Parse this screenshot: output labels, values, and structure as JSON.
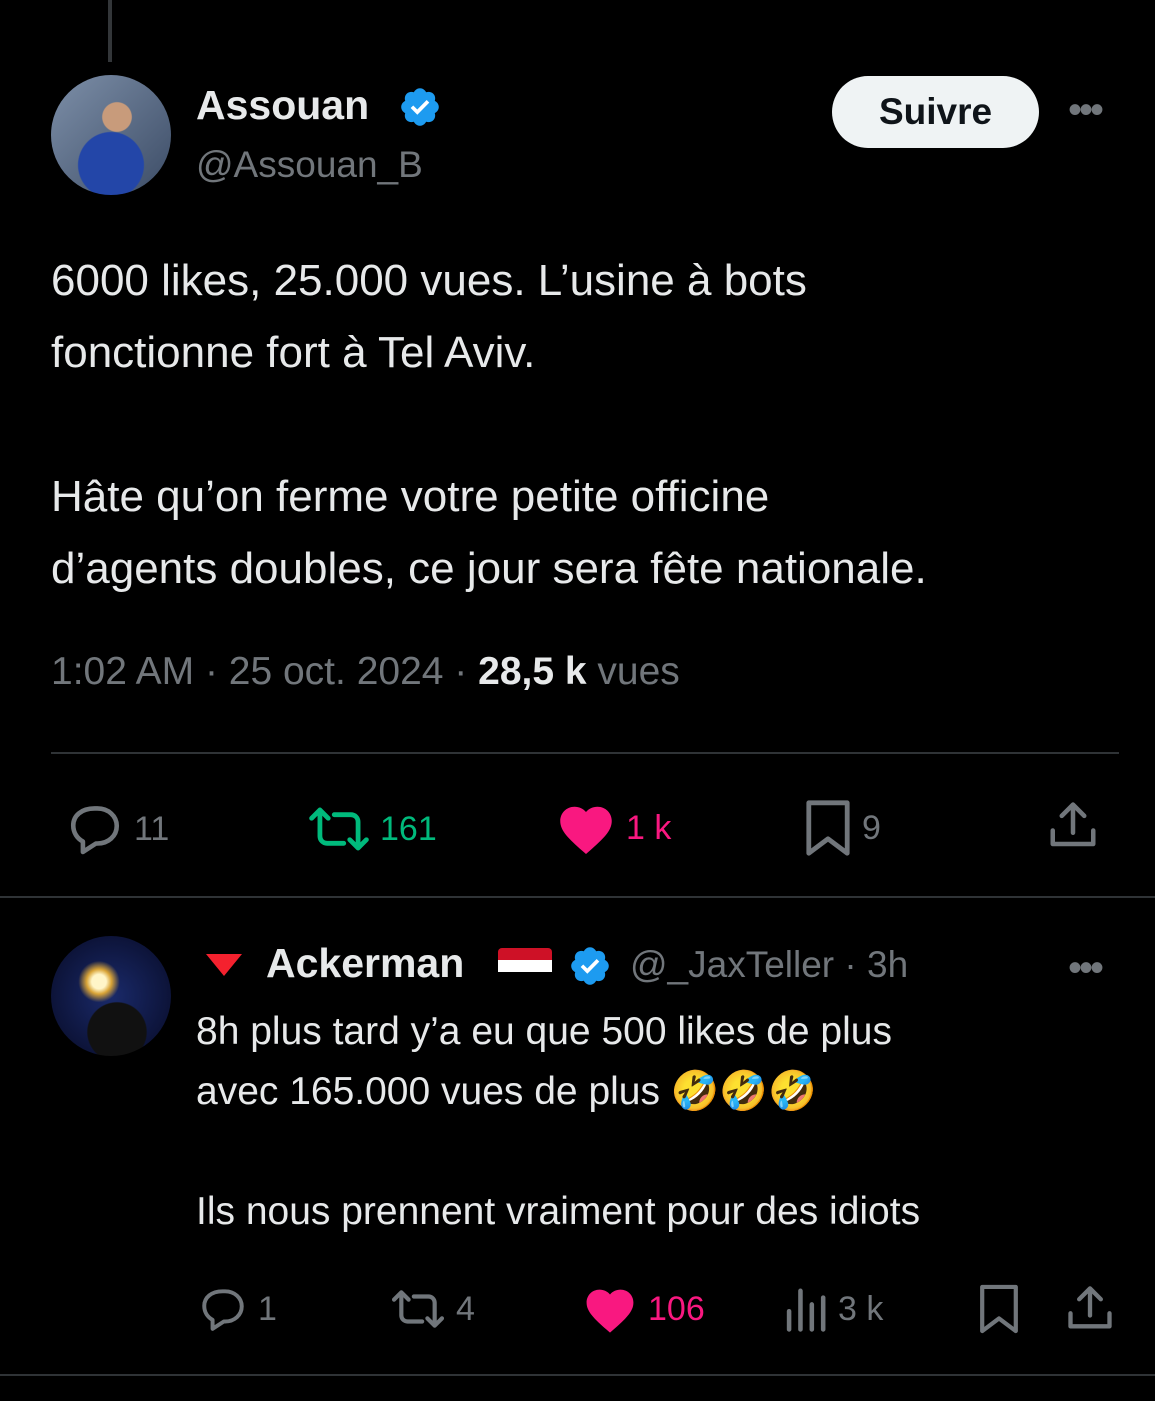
{
  "colors": {
    "background": "#000000",
    "text": "#e7e9ea",
    "muted": "#71767b",
    "verified": "#1d9bf0",
    "retweet_green": "#00ba7c",
    "like_pink": "#f91880",
    "downvote_red": "#f4212e"
  },
  "main_tweet": {
    "author_name": "Assouan",
    "author_handle": "@Assouan_B",
    "follow_label": "Suivre",
    "more_icon": "more-horizontal-icon",
    "text": "6000 likes, 25.000 vues. L’usine à bots\nfonctionne fort à Tel Aviv.\n\nHâte qu’on ferme votre petite officine\nd’agents doubles, ce jour sera fête nationale.",
    "time": "1:02 AM",
    "date": "25 oct. 2024",
    "separator": "·",
    "views_count": "28,5 k",
    "views_label": "vues",
    "actions": {
      "replies": "11",
      "retweets": "161",
      "likes": "1 k",
      "bookmarks": "9"
    }
  },
  "reply": {
    "author_name": "Ackerman",
    "author_handle": "@_JaxTeller",
    "time": "3h",
    "separator": "·",
    "flag_icon": "yemen-flag-icon",
    "more_icon": "more-horizontal-icon",
    "text": "8h plus tard y’a eu que 500 likes de plus\navec 165.000 vues de plus 🤣🤣🤣\n\nIls nous prennent vraiment pour des idiots",
    "actions": {
      "replies": "1",
      "retweets": "4",
      "likes": "106",
      "views": "3 k"
    }
  }
}
